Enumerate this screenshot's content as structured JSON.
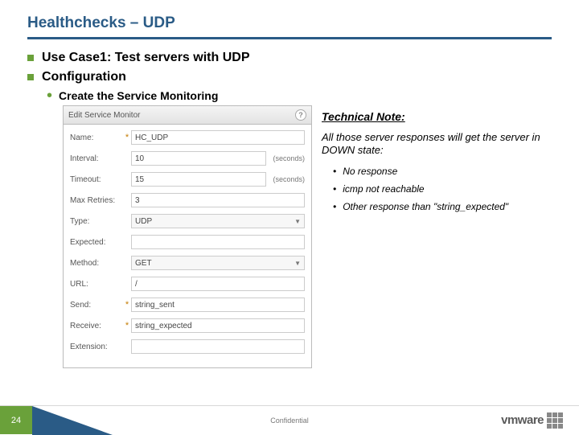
{
  "title": "Healthchecks – UDP",
  "bullets": {
    "usecase": "Use Case1: Test servers with UDP",
    "config": "Configuration",
    "create": "Create the Service Monitoring"
  },
  "dialog": {
    "header": "Edit Service Monitor",
    "rows": {
      "name": {
        "label": "Name:",
        "req": true,
        "value": "HC_UDP"
      },
      "interval": {
        "label": "Interval:",
        "req": false,
        "value": "10",
        "unit": "(seconds)"
      },
      "timeout": {
        "label": "Timeout:",
        "req": false,
        "value": "15",
        "unit": "(seconds)"
      },
      "maxretries": {
        "label": "Max Retries:",
        "req": false,
        "value": "3"
      },
      "type": {
        "label": "Type:",
        "req": false,
        "value": "UDP"
      },
      "expected": {
        "label": "Expected:",
        "req": false,
        "value": ""
      },
      "method": {
        "label": "Method:",
        "req": false,
        "value": "GET"
      },
      "url": {
        "label": "URL:",
        "req": false,
        "value": "/"
      },
      "send": {
        "label": "Send:",
        "req": true,
        "value": "string_sent"
      },
      "receive": {
        "label": "Receive:",
        "req": true,
        "value": "string_expected"
      },
      "extension": {
        "label": "Extension:",
        "req": false,
        "value": ""
      }
    }
  },
  "note": {
    "title": "Technical Note:",
    "body": "All those server responses will get the server in DOWN state:",
    "items": [
      "No response",
      "icmp not reachable",
      "Other response than \"string_expected\""
    ]
  },
  "footer": {
    "page": "24",
    "confidential": "Confidential",
    "logo": "vmware"
  }
}
